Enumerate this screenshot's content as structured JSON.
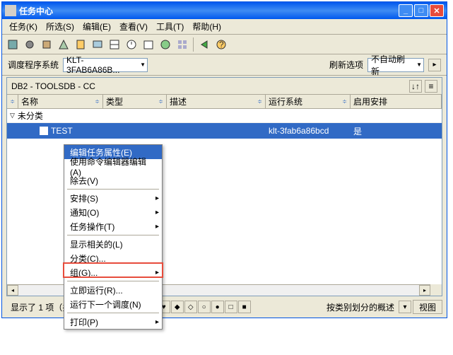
{
  "title": "任务中心",
  "menus": [
    "任务(K)",
    "所选(S)",
    "编辑(E)",
    "查看(V)",
    "工具(T)",
    "帮助(H)"
  ],
  "config": {
    "sched_label": "调度程序系统",
    "sched_value": "KLT-3FAB6A86B...",
    "refresh_label": "刷新选项",
    "refresh_value": "不自动刷新"
  },
  "path": "DB2 - TOOLSDB - CC",
  "columns": [
    "",
    "名称",
    "类型",
    "描述",
    "运行系统",
    "启用安排"
  ],
  "group_label": "未分类",
  "row": {
    "name": "TEST",
    "type": "",
    "desc": "",
    "system": "klt-3fab6a86bcd",
    "enabled": "是"
  },
  "context_menu": [
    {
      "label": "编辑任务属性(E)",
      "sel": true
    },
    {
      "label": "使用命令编辑器编辑(A)"
    },
    {
      "label": "除去(V)"
    },
    {
      "sep": true
    },
    {
      "label": "安排(S)",
      "sub": true
    },
    {
      "label": "通知(O)",
      "sub": true
    },
    {
      "label": "任务操作(T)",
      "sub": true
    },
    {
      "sep": true
    },
    {
      "label": "显示相关的(L)"
    },
    {
      "label": "分类(C)..."
    },
    {
      "label": "组(G)...",
      "sub": true
    },
    {
      "sep": true
    },
    {
      "label": "立即运行(R)..."
    },
    {
      "label": "运行下一个调度(N)"
    },
    {
      "sep": true
    },
    {
      "label": "打印(P)",
      "sub": true
    }
  ],
  "status": {
    "count_text": "显示了 1 项（共 1 项）",
    "group_label": "按类别划分的概述",
    "view_btn": "视图"
  }
}
